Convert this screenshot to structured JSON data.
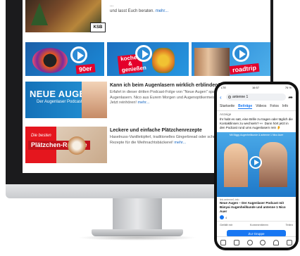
{
  "monitor": {
    "top_article": {
      "logo": "KSB",
      "text_line1": "...",
      "text_line2": "und lasst Euch beraten.",
      "more": "mehr..."
    },
    "tiles": [
      {
        "name": "90er",
        "label": "90er"
      },
      {
        "name": "kochen",
        "label": "kochen & genießen"
      },
      {
        "name": "roadtrip",
        "label": "roadtrip"
      }
    ],
    "article1": {
      "thumb_title": "NEUE AUGEN",
      "thumb_subtitle": "Der Augenlaser Podcast",
      "headline": "Kann ich beim Augenlasern wirklich erblinden?",
      "body": "Erfahrt in dieser dritten Podcast-Folge von \"Neue Augen\" spannendes zum Augenlasern. Nico aus Eurem Morgen und Augenoptikermeisterin Biggy ...",
      "more_tail": "Jetzt reinhören!",
      "more": "mehr..."
    },
    "article2": {
      "thumb_badge": "Die besten",
      "thumb_label": "Plätzchen-Rezepte",
      "headline": "Leckere und einfache Plätzchenrezepte",
      "body": "Haselnuss-Vanillekipferl, traditionelles Gingerbread oder schnelle Aus... Rezepte für die Weihnachtsbäckerei!",
      "more": "mehr..."
    }
  },
  "phone": {
    "status": {
      "time": "16:57",
      "network": "LTE",
      "battery": "76 %"
    },
    "search": {
      "query": "antenne 1"
    },
    "tabs": [
      "Startseite",
      "Beiträge",
      "Videos",
      "Fotos",
      "Info"
    ],
    "active_tab": "Beiträge",
    "section_label": "Anzeige",
    "post_text": "Ihr habt es satt, eine Brille zu tragen oder täglich die Kontaktlinsen zu wechseln? 👀 Dann hört jetzt in den Podcast rund ums Augenlasern rein 👂",
    "image_caption": "Mit Biggy Augenheilkunde & antenne 1 Nico Auer",
    "link_url": "link.antenne1.info",
    "link_title": "Neue Augen – Der Augenlaser Podcast mit Bányai Augenheilkunde und antenne 1 Nico Auer",
    "reactions_count": "4",
    "actions": {
      "like": "Gefällt mir",
      "comment": "Kommentieren",
      "share": "Teilen"
    },
    "cta": "Zur Gruppe",
    "colors": {
      "accent": "#1877f2"
    }
  }
}
